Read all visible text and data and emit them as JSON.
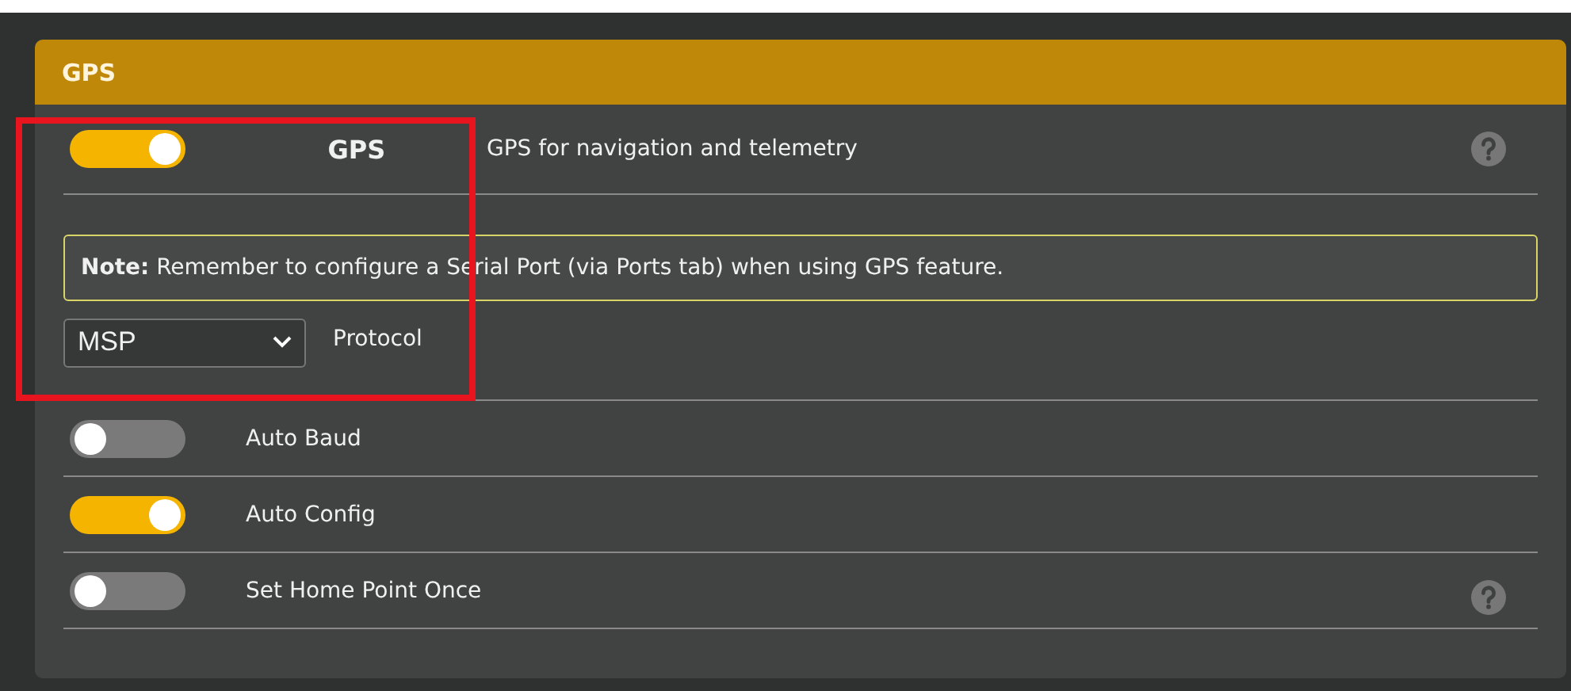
{
  "panel": {
    "title": "GPS"
  },
  "gps": {
    "on": true,
    "label": "GPS",
    "description": "GPS for navigation and telemetry",
    "help": true
  },
  "note": {
    "text": "**Note:** Remember to configure a Serial Port (via Ports tab) when using GPS feature."
  },
  "protocol": {
    "value": "MSP",
    "label": "Protocol"
  },
  "options": [
    {
      "label": "Auto Baud",
      "on": false,
      "help": false
    },
    {
      "label": "Auto Config",
      "on": true,
      "help": false
    },
    {
      "label": "Set Home Point Once",
      "on": false,
      "help": true
    }
  ],
  "annotation": {
    "kind": "frame"
  }
}
